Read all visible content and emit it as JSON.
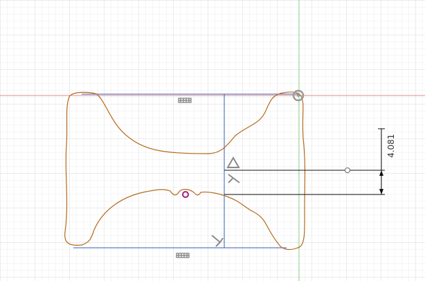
{
  "viewport": {
    "name": "sketch-canvas",
    "colors": {
      "background": "#ffffff",
      "minor_grid": "#e9e9e9",
      "major_grid": "#d6d6d6",
      "x_axis": "#e88a8a",
      "y_axis": "#8bd08b",
      "sketch_profile": "#b5691c",
      "construction_lines": "#2f5fb5",
      "dimension_lines": "#111111",
      "constraint_glyphs": "#8a8a8a",
      "selected_point": "#a0207a"
    }
  },
  "dimension": {
    "value": "4.081"
  },
  "icons": {
    "origin": "origin-icon",
    "horizontal_top": "horizontal-constraint-icon",
    "horizontal_bottom": "horizontal-constraint-icon",
    "midpoint": "midpoint-constraint-icon",
    "perpendicular_upper": "perpendicular-constraint-icon",
    "perpendicular_lower": "perpendicular-constraint-icon",
    "sketch_point": "sketch-point-icon"
  }
}
